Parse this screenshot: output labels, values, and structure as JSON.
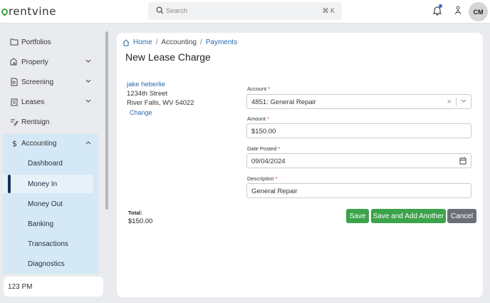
{
  "app": {
    "logo_text": "rentvine"
  },
  "search": {
    "placeholder": "Search",
    "shortcut": "⌘ K"
  },
  "user": {
    "initials": "CM"
  },
  "sidebar": {
    "items": [
      {
        "label": "Portfolios",
        "icon": "folder-icon"
      },
      {
        "label": "Property",
        "icon": "building-icon",
        "chevron": "down"
      },
      {
        "label": "Screening",
        "icon": "document-search-icon",
        "chevron": "down"
      },
      {
        "label": "Leases",
        "icon": "clipboard-icon",
        "chevron": "down"
      },
      {
        "label": "Rentsign",
        "icon": "sign-icon"
      },
      {
        "label": "Accounting",
        "icon": "dollar-icon",
        "chevron": "up",
        "expanded": true
      }
    ],
    "accounting_sub": [
      {
        "label": "Dashboard"
      },
      {
        "label": "Money In",
        "active": true
      },
      {
        "label": "Money Out"
      },
      {
        "label": "Banking"
      },
      {
        "label": "Transactions"
      },
      {
        "label": "Diagnostics"
      }
    ],
    "time_label": "123 PM"
  },
  "breadcrumb": {
    "home": "Home",
    "accounting": "Accounting",
    "payments": "Payments"
  },
  "page": {
    "title": "New Lease Charge"
  },
  "tenant": {
    "name": "jake heberlie",
    "street": "1234th Street",
    "city": "River Falls, WV 54022",
    "change_label": "Change"
  },
  "form": {
    "account": {
      "label": "Account",
      "required_mark": "*",
      "value": "4851: General Repair"
    },
    "amount": {
      "label": "Amount",
      "required_mark": "*",
      "value": "$150.00"
    },
    "date_posted": {
      "label": "Date Posted",
      "required_mark": "*",
      "value": "09/04/2024"
    },
    "description": {
      "label": "Description",
      "required_mark": "*",
      "value": "General Repair"
    }
  },
  "total": {
    "label": "Total:",
    "value": "$150.00"
  },
  "buttons": {
    "save": "Save",
    "save_add": "Save and Add Another",
    "cancel": "Cancel"
  },
  "colors": {
    "primary_green": "#3ba34a",
    "link_blue": "#2a6bb0",
    "nav_active_bar": "#12355b",
    "accounting_bg": "#d4e8f5"
  }
}
